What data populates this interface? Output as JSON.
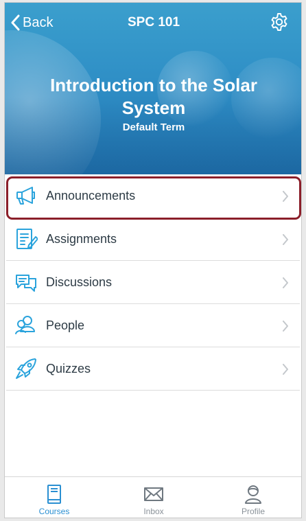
{
  "header": {
    "back_label": "Back",
    "course_code": "SPC 101",
    "course_title": "Introduction to the Solar System",
    "term": "Default Term"
  },
  "menu": {
    "items": [
      {
        "label": "Announcements",
        "icon": "megaphone-icon",
        "selected": true
      },
      {
        "label": "Assignments",
        "icon": "assignment-icon",
        "selected": false
      },
      {
        "label": "Discussions",
        "icon": "discussions-icon",
        "selected": false
      },
      {
        "label": "People",
        "icon": "people-icon",
        "selected": false
      },
      {
        "label": "Quizzes",
        "icon": "rocket-icon",
        "selected": false
      }
    ]
  },
  "tabbar": {
    "tabs": [
      {
        "label": "Courses",
        "icon": "book-icon",
        "active": true
      },
      {
        "label": "Inbox",
        "icon": "envelope-icon",
        "active": false
      },
      {
        "label": "Profile",
        "icon": "profile-icon",
        "active": false
      }
    ]
  },
  "colors": {
    "accent": "#2a8fd2",
    "icon_blue": "#2aa3dc",
    "selection_outline": "#8b1f2a",
    "text": "#2d3b45"
  }
}
